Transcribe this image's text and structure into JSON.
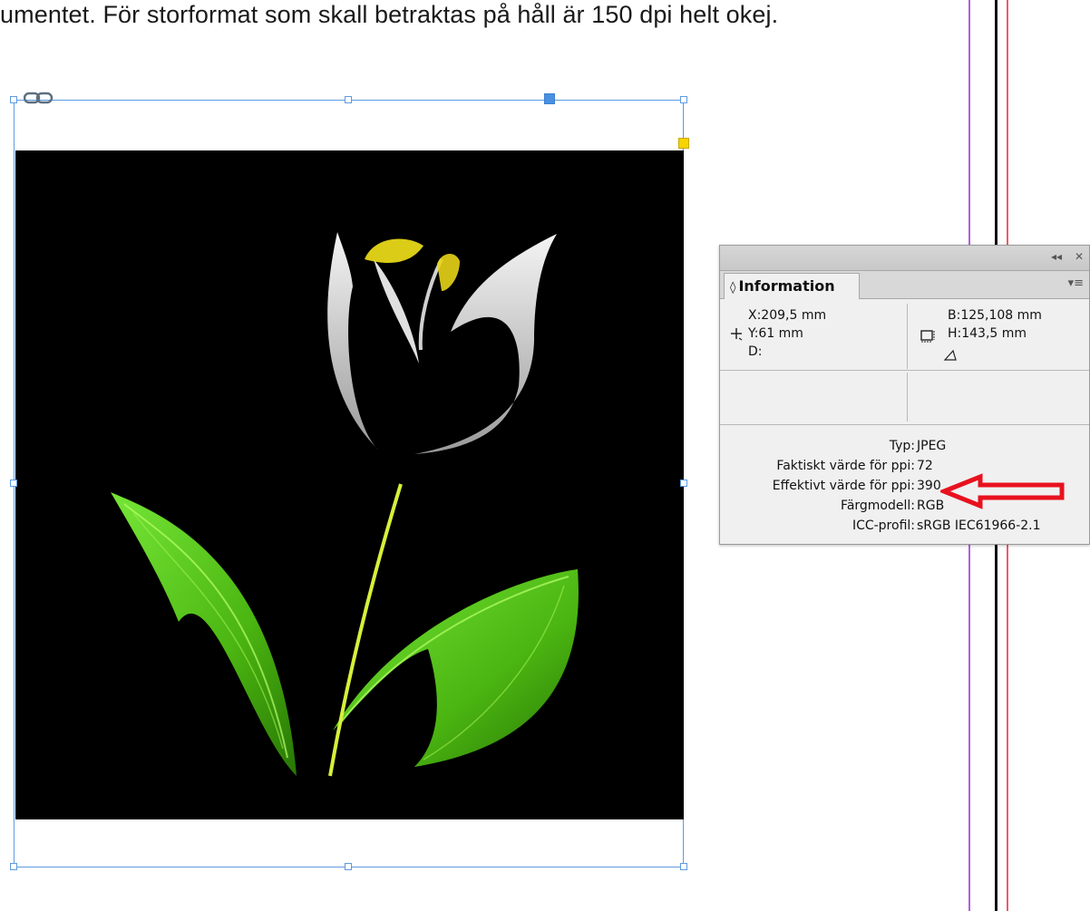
{
  "document": {
    "text_line": "umentet. För storformat som skall betraktas på håll är 150 dpi helt okej."
  },
  "panel": {
    "title": "Information",
    "tab_arrows": "◊",
    "collapse_button": "◂◂",
    "close_button": "✕",
    "menu_button": "▾≡",
    "x": "X:209,5 mm",
    "y": "Y:61 mm",
    "d": "D:",
    "b": "B:125,108 mm",
    "h": "H:143,5 mm",
    "typ_label": "Typ:",
    "typ_value": "JPEG",
    "faktiskt_label": "Faktiskt värde för ppi:",
    "faktiskt_value": "72",
    "effektivt_label": "Effektivt värde för ppi:",
    "effektivt_value": "390",
    "fargmodell_label": "Färgmodell:",
    "fargmodell_value": "RGB",
    "icc_label": "ICC-profil:",
    "icc_value": "sRGB IEC61966-2.1"
  },
  "icons": {
    "crosshair": "crosshair-icon",
    "size": "frame-size-icon",
    "angle": "angle-icon",
    "link": "link-icon",
    "annotation": "red-arrow-icon"
  },
  "colors": {
    "selection": "#5d9be0",
    "guide_purple": "#b35ee0",
    "guide_red": "#ee5a6a",
    "annotation_arrow": "#e8121e",
    "leaf_green": "#6fe02a",
    "petal_white": "#e8e8e8",
    "flower_yellow": "#f2e21a"
  }
}
